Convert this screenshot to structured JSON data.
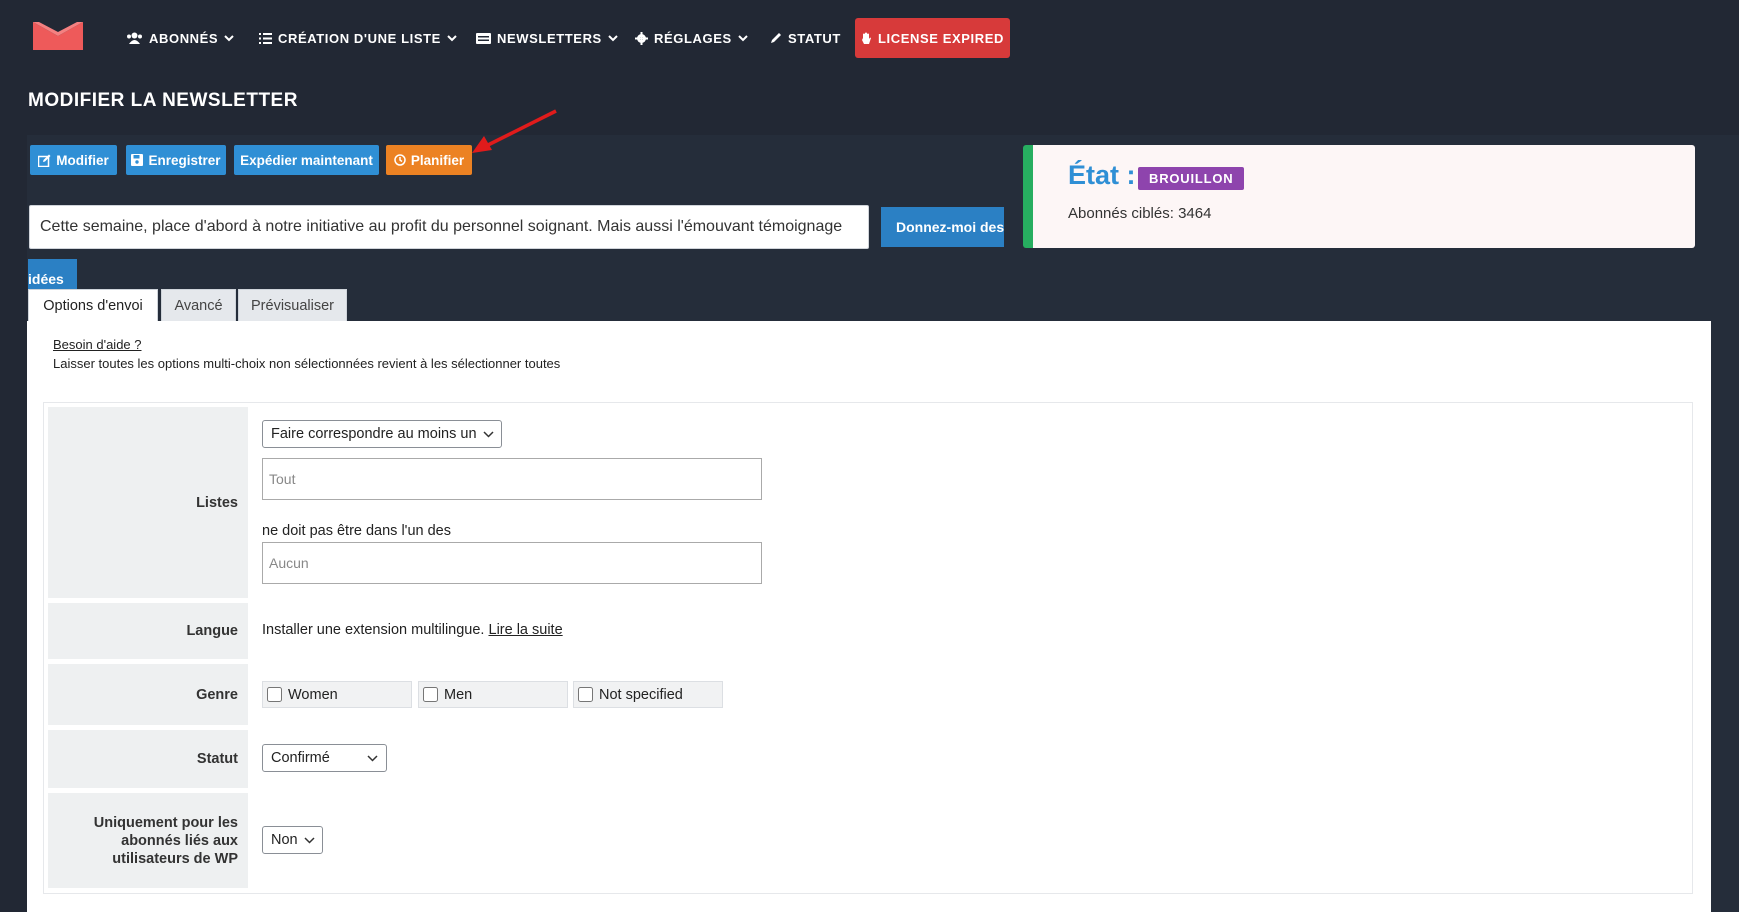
{
  "nav": {
    "items": [
      {
        "label": "ABONNÉS",
        "icon": "users-icon"
      },
      {
        "label": "CRÉATION D'UNE LISTE",
        "icon": "list-icon"
      },
      {
        "label": "NEWSLETTERS",
        "icon": "newspaper-icon"
      },
      {
        "label": "RÉGLAGES",
        "icon": "gear-icon"
      },
      {
        "label": "STATUT",
        "icon": "pencil-icon"
      }
    ],
    "license": "LICENSE EXPIRED"
  },
  "page_title": "MODIFIER LA NEWSLETTER",
  "actions": {
    "edit": "Modifier",
    "save": "Enregistrer",
    "send_now": "Expédier maintenant",
    "schedule": "Planifier"
  },
  "subject": {
    "value": "Cette semaine, place d'abord à notre initiative au profit du personnel soignant. Mais aussi l'émouvant témoignage",
    "ideas_button_line1": "Donnez-moi des",
    "ideas_button_line2": "idées"
  },
  "status": {
    "label": "État :",
    "badge": "BROUILLON",
    "subscribers": "Abonnés ciblés: 3464"
  },
  "tabs": [
    "Options d'envoi",
    "Avancé",
    "Prévisualiser"
  ],
  "help": {
    "link": "Besoin d'aide ?",
    "text": "Laisser toutes les options multi-choix non sélectionnées revient à les sélectionner toutes"
  },
  "form": {
    "lists": {
      "label": "Listes",
      "match_select": "Faire correspondre au moins un",
      "include_placeholder": "Tout",
      "exclude_label": "ne doit pas être dans l'un des",
      "exclude_placeholder": "Aucun"
    },
    "language": {
      "label": "Langue",
      "text": "Installer une extension multilingue.",
      "link": "Lire la suite"
    },
    "gender": {
      "label": "Genre",
      "options": [
        "Women",
        "Men",
        "Not specified"
      ]
    },
    "status": {
      "label": "Statut",
      "selected": "Confirmé"
    },
    "wp_only": {
      "label": "Uniquement pour les abonnés liés aux utilisateurs de WP",
      "selected": "Non"
    }
  },
  "colors": {
    "background": "#222834",
    "accent_blue": "#2f8fd5",
    "orange": "#ec8223",
    "license_red": "#d73a3a",
    "badge_purple": "#8e44ad",
    "status_green": "#27ae60"
  }
}
